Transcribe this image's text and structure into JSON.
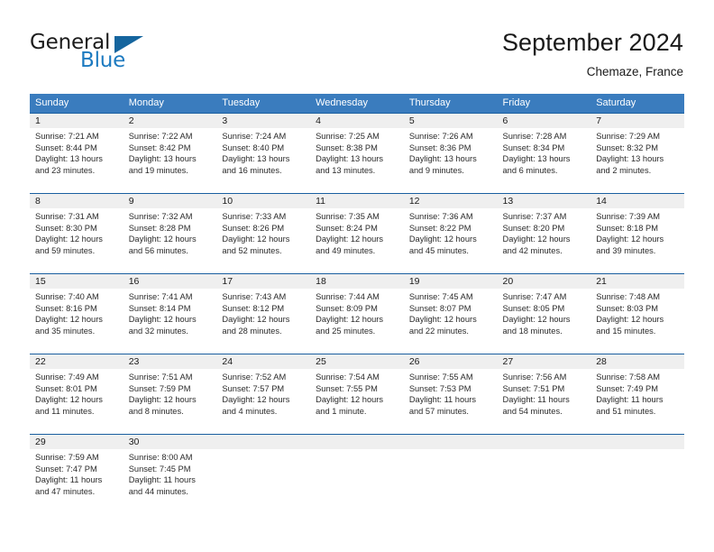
{
  "brand": {
    "name_part1": "General",
    "name_part2": "Blue",
    "flag_icon": "blue-triangle-flag-icon"
  },
  "header": {
    "title": "September 2024",
    "location": "Chemaze, France"
  },
  "colors": {
    "header_blue": "#3a7cbe",
    "rule_blue": "#1a5fa0",
    "number_band_gray": "#efefef",
    "brand_blue": "#1c7ac0",
    "text": "#1a1a1a"
  },
  "weekdays": [
    "Sunday",
    "Monday",
    "Tuesday",
    "Wednesday",
    "Thursday",
    "Friday",
    "Saturday"
  ],
  "weeks": [
    [
      {
        "day": "1",
        "sunrise": "Sunrise: 7:21 AM",
        "sunset": "Sunset: 8:44 PM",
        "daylight1": "Daylight: 13 hours",
        "daylight2": "and 23 minutes."
      },
      {
        "day": "2",
        "sunrise": "Sunrise: 7:22 AM",
        "sunset": "Sunset: 8:42 PM",
        "daylight1": "Daylight: 13 hours",
        "daylight2": "and 19 minutes."
      },
      {
        "day": "3",
        "sunrise": "Sunrise: 7:24 AM",
        "sunset": "Sunset: 8:40 PM",
        "daylight1": "Daylight: 13 hours",
        "daylight2": "and 16 minutes."
      },
      {
        "day": "4",
        "sunrise": "Sunrise: 7:25 AM",
        "sunset": "Sunset: 8:38 PM",
        "daylight1": "Daylight: 13 hours",
        "daylight2": "and 13 minutes."
      },
      {
        "day": "5",
        "sunrise": "Sunrise: 7:26 AM",
        "sunset": "Sunset: 8:36 PM",
        "daylight1": "Daylight: 13 hours",
        "daylight2": "and 9 minutes."
      },
      {
        "day": "6",
        "sunrise": "Sunrise: 7:28 AM",
        "sunset": "Sunset: 8:34 PM",
        "daylight1": "Daylight: 13 hours",
        "daylight2": "and 6 minutes."
      },
      {
        "day": "7",
        "sunrise": "Sunrise: 7:29 AM",
        "sunset": "Sunset: 8:32 PM",
        "daylight1": "Daylight: 13 hours",
        "daylight2": "and 2 minutes."
      }
    ],
    [
      {
        "day": "8",
        "sunrise": "Sunrise: 7:31 AM",
        "sunset": "Sunset: 8:30 PM",
        "daylight1": "Daylight: 12 hours",
        "daylight2": "and 59 minutes."
      },
      {
        "day": "9",
        "sunrise": "Sunrise: 7:32 AM",
        "sunset": "Sunset: 8:28 PM",
        "daylight1": "Daylight: 12 hours",
        "daylight2": "and 56 minutes."
      },
      {
        "day": "10",
        "sunrise": "Sunrise: 7:33 AM",
        "sunset": "Sunset: 8:26 PM",
        "daylight1": "Daylight: 12 hours",
        "daylight2": "and 52 minutes."
      },
      {
        "day": "11",
        "sunrise": "Sunrise: 7:35 AM",
        "sunset": "Sunset: 8:24 PM",
        "daylight1": "Daylight: 12 hours",
        "daylight2": "and 49 minutes."
      },
      {
        "day": "12",
        "sunrise": "Sunrise: 7:36 AM",
        "sunset": "Sunset: 8:22 PM",
        "daylight1": "Daylight: 12 hours",
        "daylight2": "and 45 minutes."
      },
      {
        "day": "13",
        "sunrise": "Sunrise: 7:37 AM",
        "sunset": "Sunset: 8:20 PM",
        "daylight1": "Daylight: 12 hours",
        "daylight2": "and 42 minutes."
      },
      {
        "day": "14",
        "sunrise": "Sunrise: 7:39 AM",
        "sunset": "Sunset: 8:18 PM",
        "daylight1": "Daylight: 12 hours",
        "daylight2": "and 39 minutes."
      }
    ],
    [
      {
        "day": "15",
        "sunrise": "Sunrise: 7:40 AM",
        "sunset": "Sunset: 8:16 PM",
        "daylight1": "Daylight: 12 hours",
        "daylight2": "and 35 minutes."
      },
      {
        "day": "16",
        "sunrise": "Sunrise: 7:41 AM",
        "sunset": "Sunset: 8:14 PM",
        "daylight1": "Daylight: 12 hours",
        "daylight2": "and 32 minutes."
      },
      {
        "day": "17",
        "sunrise": "Sunrise: 7:43 AM",
        "sunset": "Sunset: 8:12 PM",
        "daylight1": "Daylight: 12 hours",
        "daylight2": "and 28 minutes."
      },
      {
        "day": "18",
        "sunrise": "Sunrise: 7:44 AM",
        "sunset": "Sunset: 8:09 PM",
        "daylight1": "Daylight: 12 hours",
        "daylight2": "and 25 minutes."
      },
      {
        "day": "19",
        "sunrise": "Sunrise: 7:45 AM",
        "sunset": "Sunset: 8:07 PM",
        "daylight1": "Daylight: 12 hours",
        "daylight2": "and 22 minutes."
      },
      {
        "day": "20",
        "sunrise": "Sunrise: 7:47 AM",
        "sunset": "Sunset: 8:05 PM",
        "daylight1": "Daylight: 12 hours",
        "daylight2": "and 18 minutes."
      },
      {
        "day": "21",
        "sunrise": "Sunrise: 7:48 AM",
        "sunset": "Sunset: 8:03 PM",
        "daylight1": "Daylight: 12 hours",
        "daylight2": "and 15 minutes."
      }
    ],
    [
      {
        "day": "22",
        "sunrise": "Sunrise: 7:49 AM",
        "sunset": "Sunset: 8:01 PM",
        "daylight1": "Daylight: 12 hours",
        "daylight2": "and 11 minutes."
      },
      {
        "day": "23",
        "sunrise": "Sunrise: 7:51 AM",
        "sunset": "Sunset: 7:59 PM",
        "daylight1": "Daylight: 12 hours",
        "daylight2": "and 8 minutes."
      },
      {
        "day": "24",
        "sunrise": "Sunrise: 7:52 AM",
        "sunset": "Sunset: 7:57 PM",
        "daylight1": "Daylight: 12 hours",
        "daylight2": "and 4 minutes."
      },
      {
        "day": "25",
        "sunrise": "Sunrise: 7:54 AM",
        "sunset": "Sunset: 7:55 PM",
        "daylight1": "Daylight: 12 hours",
        "daylight2": "and 1 minute."
      },
      {
        "day": "26",
        "sunrise": "Sunrise: 7:55 AM",
        "sunset": "Sunset: 7:53 PM",
        "daylight1": "Daylight: 11 hours",
        "daylight2": "and 57 minutes."
      },
      {
        "day": "27",
        "sunrise": "Sunrise: 7:56 AM",
        "sunset": "Sunset: 7:51 PM",
        "daylight1": "Daylight: 11 hours",
        "daylight2": "and 54 minutes."
      },
      {
        "day": "28",
        "sunrise": "Sunrise: 7:58 AM",
        "sunset": "Sunset: 7:49 PM",
        "daylight1": "Daylight: 11 hours",
        "daylight2": "and 51 minutes."
      }
    ],
    [
      {
        "day": "29",
        "sunrise": "Sunrise: 7:59 AM",
        "sunset": "Sunset: 7:47 PM",
        "daylight1": "Daylight: 11 hours",
        "daylight2": "and 47 minutes."
      },
      {
        "day": "30",
        "sunrise": "Sunrise: 8:00 AM",
        "sunset": "Sunset: 7:45 PM",
        "daylight1": "Daylight: 11 hours",
        "daylight2": "and 44 minutes."
      },
      {
        "day": "",
        "sunrise": "",
        "sunset": "",
        "daylight1": "",
        "daylight2": ""
      },
      {
        "day": "",
        "sunrise": "",
        "sunset": "",
        "daylight1": "",
        "daylight2": ""
      },
      {
        "day": "",
        "sunrise": "",
        "sunset": "",
        "daylight1": "",
        "daylight2": ""
      },
      {
        "day": "",
        "sunrise": "",
        "sunset": "",
        "daylight1": "",
        "daylight2": ""
      },
      {
        "day": "",
        "sunrise": "",
        "sunset": "",
        "daylight1": "",
        "daylight2": ""
      }
    ]
  ]
}
